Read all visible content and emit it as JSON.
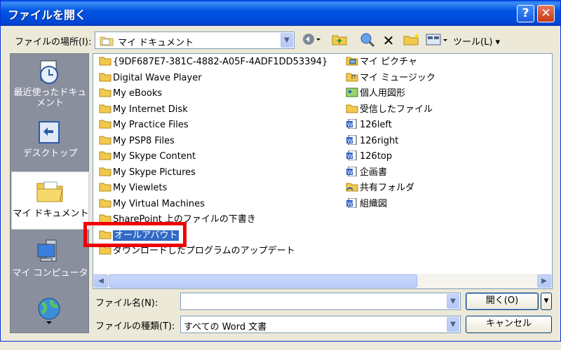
{
  "window": {
    "title": "ファイルを開く",
    "help_glyph": "?",
    "close_glyph": "✕"
  },
  "lookin": {
    "label": "ファイルの場所(I):",
    "value": "マイ ドキュメント"
  },
  "toolbar": {
    "tools_label": "ツール(L) ▾"
  },
  "places": [
    {
      "label": "最近使ったドキュメント",
      "icon": "recent-documents-icon"
    },
    {
      "label": "デスクトップ",
      "icon": "desktop-icon"
    },
    {
      "label": "マイ ドキュメント",
      "icon": "my-documents-icon"
    },
    {
      "label": "マイ コンピュータ",
      "icon": "my-computer-icon"
    },
    {
      "label": "",
      "icon": "network-places-icon"
    }
  ],
  "files": {
    "col1": [
      {
        "name": "{9DF687E7-381C-4882-A05F-4ADF1DD53394}",
        "icon": "folder-icon"
      },
      {
        "name": "Digital Wave Player",
        "icon": "folder-icon"
      },
      {
        "name": "My eBooks",
        "icon": "folder-icon"
      },
      {
        "name": "My Internet Disk",
        "icon": "folder-icon"
      },
      {
        "name": "My Practice Files",
        "icon": "folder-icon"
      },
      {
        "name": "My PSP8 Files",
        "icon": "folder-icon"
      },
      {
        "name": "My Skype Content",
        "icon": "folder-icon"
      },
      {
        "name": "My Skype Pictures",
        "icon": "folder-icon"
      },
      {
        "name": "My Viewlets",
        "icon": "folder-icon"
      },
      {
        "name": "My Virtual Machines",
        "icon": "folder-icon"
      },
      {
        "name": "SharePoint 上のファイルの下書き",
        "icon": "folder-icon"
      },
      {
        "name": "オールアバウト",
        "icon": "folder-icon",
        "selected": true
      },
      {
        "name": "ダウンロードしたプログラムのアップデート",
        "icon": "folder-icon"
      }
    ],
    "col2": [
      {
        "name": "マイ ピクチャ",
        "icon": "pictures-folder-icon"
      },
      {
        "name": "マイ ミュージック",
        "icon": "music-folder-icon"
      },
      {
        "name": "個人用図形",
        "icon": "shapes-folder-icon"
      },
      {
        "name": "受信したファイル",
        "icon": "folder-icon"
      },
      {
        "name": "126left",
        "icon": "word-doc-icon"
      },
      {
        "name": "126right",
        "icon": "word-doc-icon"
      },
      {
        "name": "126top",
        "icon": "word-doc-icon"
      },
      {
        "name": "企画書",
        "icon": "word-doc-icon"
      },
      {
        "name": "共有フォルダ",
        "icon": "shared-folder-icon"
      },
      {
        "name": "組織図",
        "icon": "word-doc-icon"
      }
    ]
  },
  "filename": {
    "label": "ファイル名(N):",
    "value": ""
  },
  "filetype": {
    "label": "ファイルの種類(T):",
    "value": "すべての Word 文書"
  },
  "buttons": {
    "open": "開く(O)",
    "cancel": "キャンセル"
  },
  "colors": {
    "accent": "#316ac5",
    "highlight_box": "#ee0000",
    "title_bar": "#0055e5"
  }
}
